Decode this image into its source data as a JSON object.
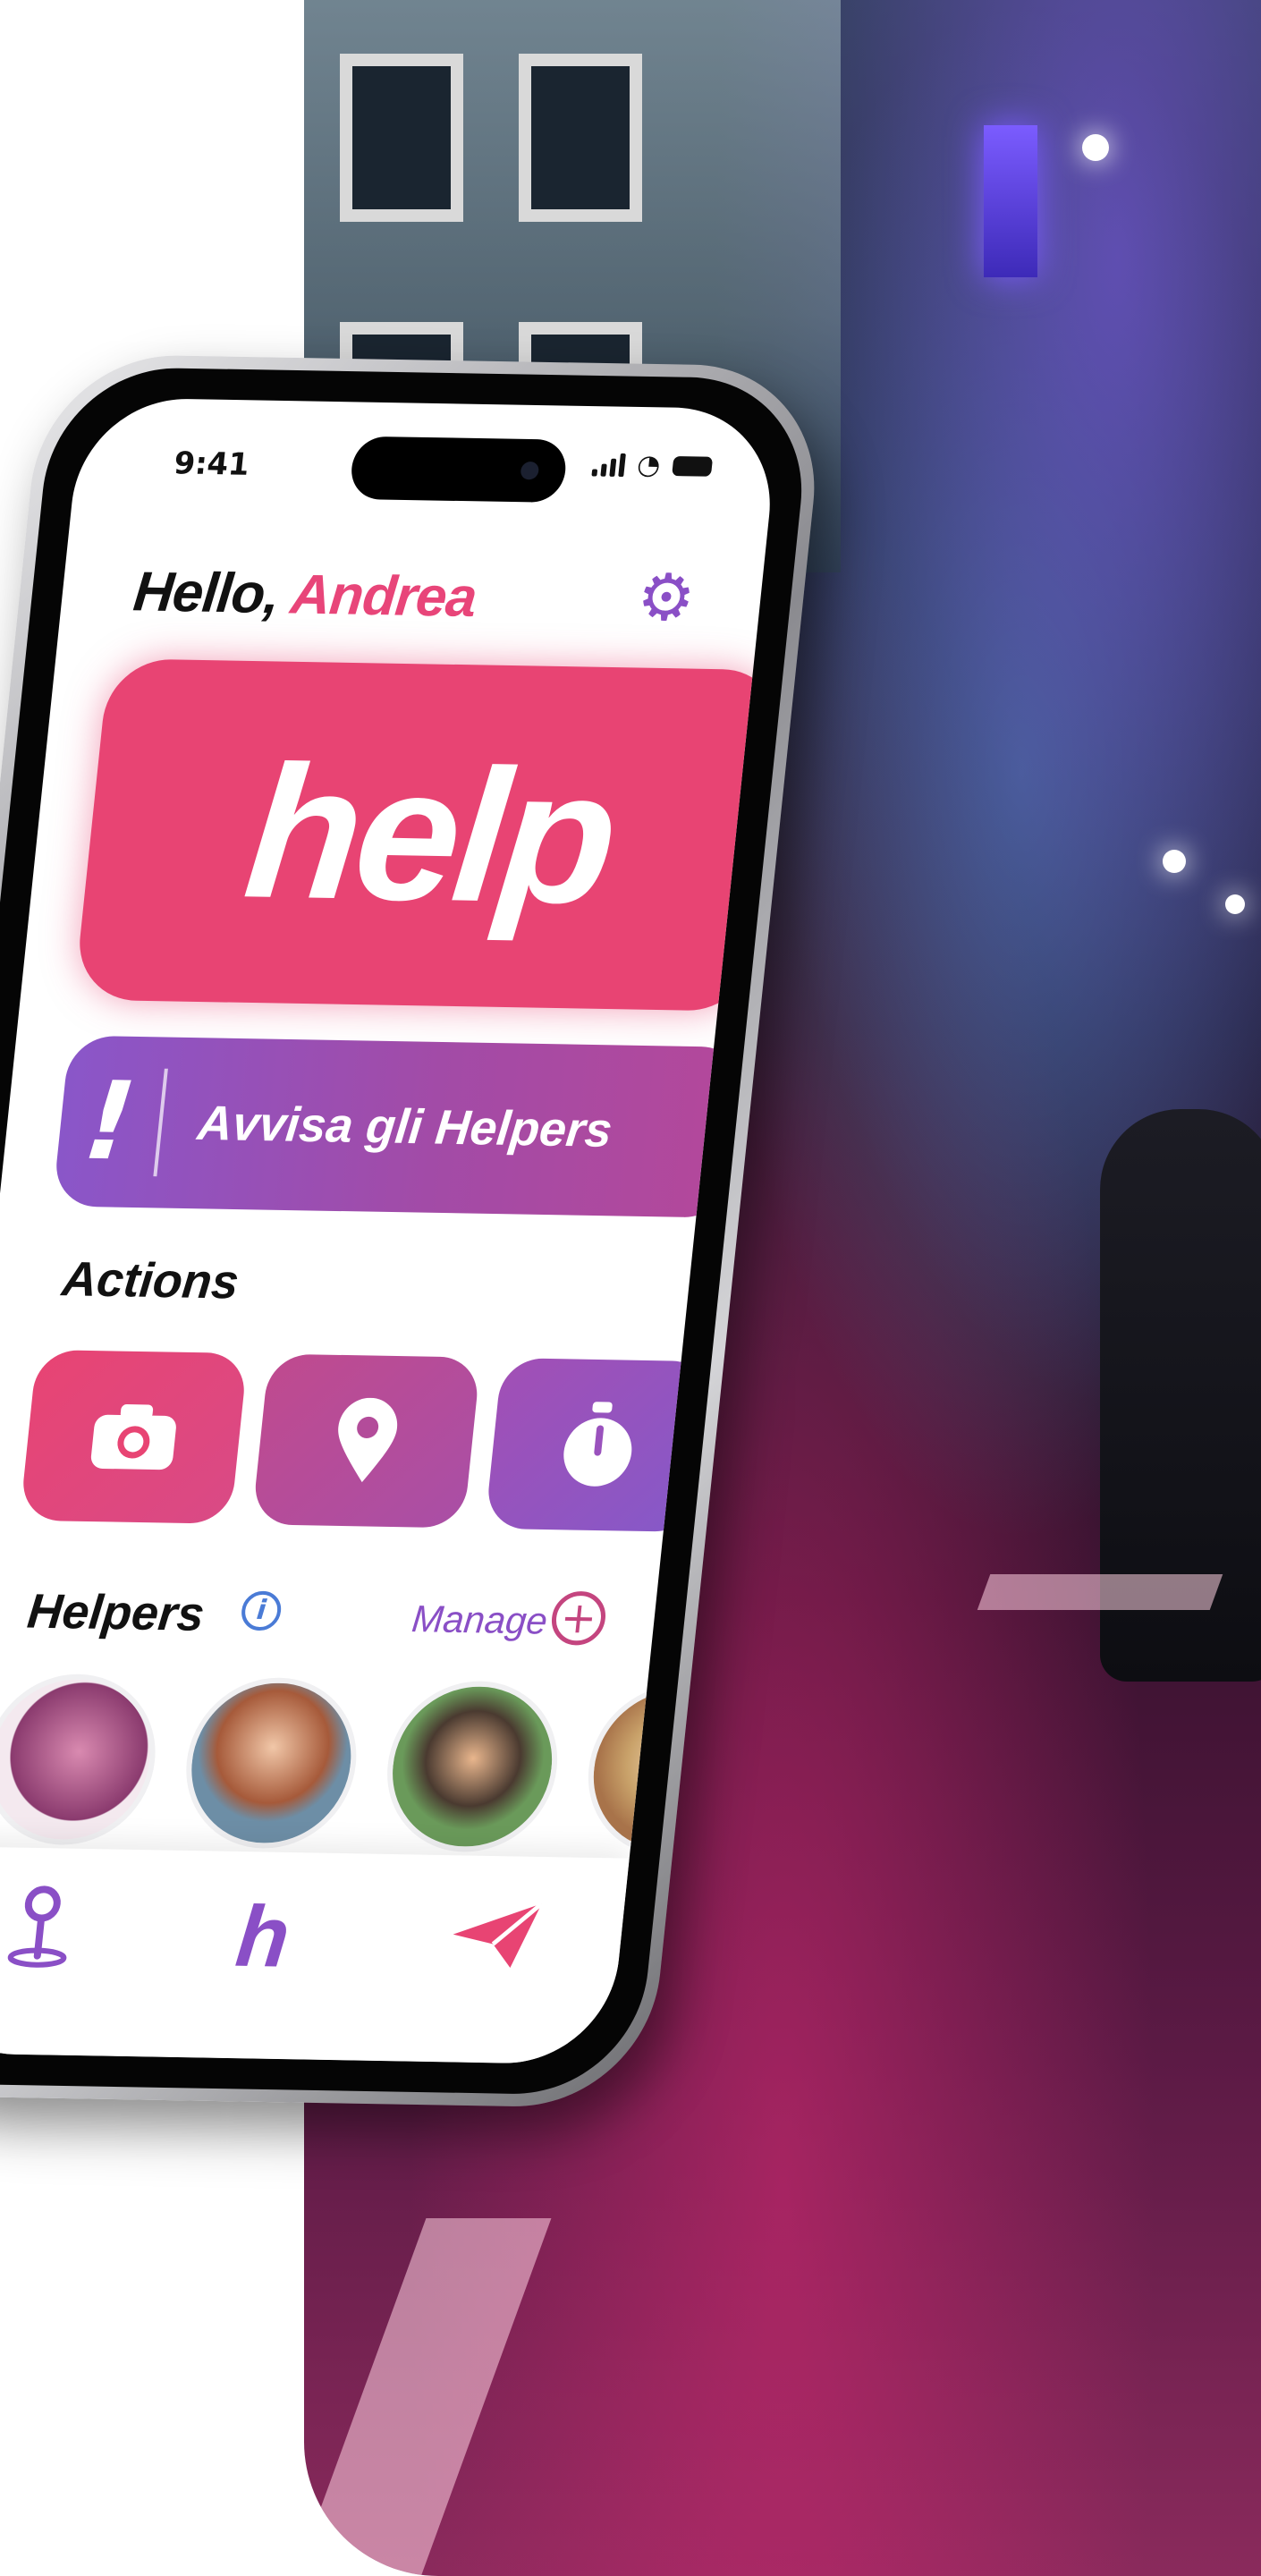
{
  "status": {
    "time": "9:41"
  },
  "header": {
    "greeting": "Hello,",
    "user_name": "Andrea"
  },
  "help_button": {
    "label": "help"
  },
  "alert_button": {
    "icon_label": "!",
    "label": "Avvisa gli Helpers"
  },
  "actions": {
    "title": "Actions",
    "items": [
      {
        "icon": "camera-icon"
      },
      {
        "icon": "location-pin-icon"
      },
      {
        "icon": "timer-icon"
      }
    ]
  },
  "helpers": {
    "title": "Helpers",
    "info_icon": "i",
    "manage_label": "Manage",
    "add_icon": "+"
  },
  "tabbar": {
    "home_label": "h"
  },
  "colors": {
    "accent_pink": "#e84473",
    "accent_purple": "#8a4fc6"
  }
}
